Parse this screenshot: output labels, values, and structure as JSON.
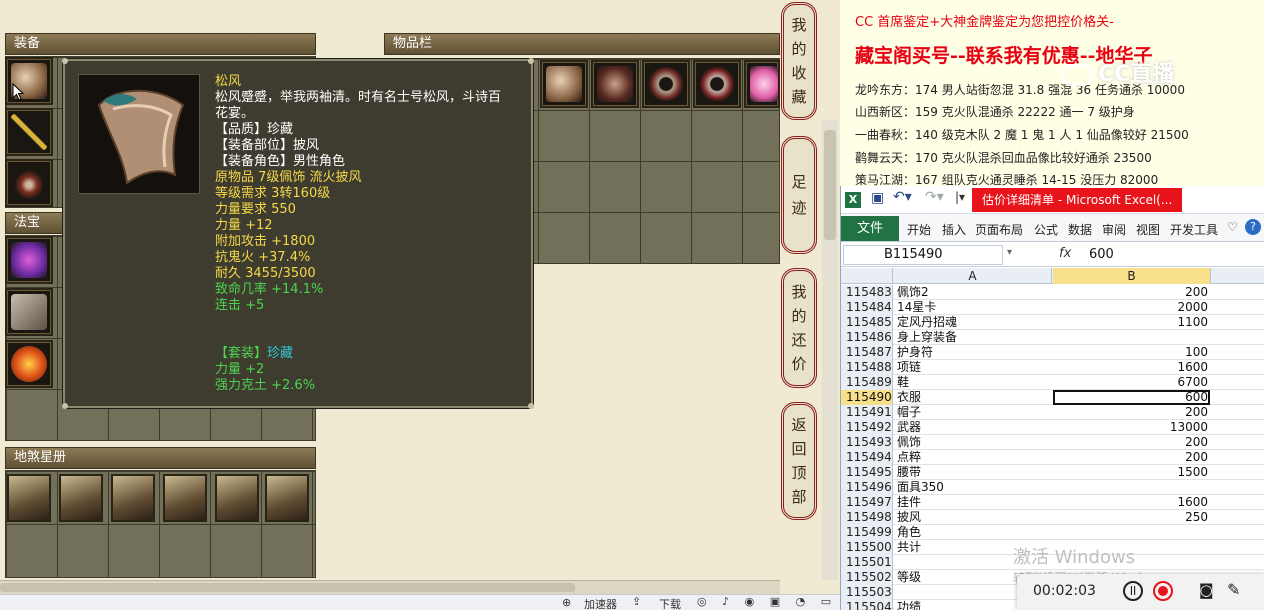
{
  "game": {
    "equip_header": "装备",
    "fabao_header": "法宝",
    "inventory_header": "物品栏",
    "dishagui_header": "地煞星册",
    "tooltip": {
      "name": "松风",
      "desc_line1": "松风蹙蹙，举我两袖清。时有名士号松风，斗诗百",
      "desc_line2": "花宴。",
      "quality": "【品质】珍藏",
      "slot": "【装备部位】披风",
      "role": "【装备角色】男性角色",
      "origin": "原物品 7级佩饰 流火披风",
      "level_req": "等级需求 3转160级",
      "str_req": "力量要求 550",
      "str": "力量 +12",
      "atk": "附加攻击 +1800",
      "resist": "抗鬼火 +37.4%",
      "durability": "耐久 3455/3500",
      "crit": "致命几率 +14.1%",
      "combo": "连击 +5",
      "set_label": "【套装】",
      "set_name": "珍藏",
      "set_str": "力量 +2",
      "set_bonus": "强力克土 +2.6%"
    },
    "bottom_bar": {
      "speed": "加速器",
      "download": "下载"
    }
  },
  "side_buttons": [
    {
      "label": "我的收藏"
    },
    {
      "label": "足迹"
    },
    {
      "label": "我的还价"
    },
    {
      "label": "返回顶部"
    }
  ],
  "right_text": {
    "line_top": "CC 首席鉴定+大神金牌鉴定为您把控价格关-",
    "headline": "藏宝阁买号--联系我有优惠--地华子",
    "items": [
      "龙吟东方：174 男人站街忽混 31.8 强混 36 任务通杀 10000",
      "山西新区：159 克火队混通杀 22222 通一 7 级护身",
      "一曲春秋：140 级克木队 2 魔 1 鬼 1 人 1 仙品像较好 21500",
      "鹳舞云天：170 克火队混杀回血品像比较好通杀 23500",
      "策马江湖：167 组队克火通灵睡杀 14-15 没压力 82000"
    ],
    "watermark": "CC直播"
  },
  "excel": {
    "title": "估价详细清单 - Microsoft Excel(...",
    "ribbon_tabs": [
      "文件",
      "开始",
      "插入",
      "页面布局",
      "公式",
      "数据",
      "审阅",
      "视图",
      "开发工具"
    ],
    "name_box": "B115490",
    "fx": "fx",
    "formula_value": "600",
    "col_a": "A",
    "col_b": "B",
    "rows": [
      {
        "n": "115483",
        "a": "佩饰2",
        "b": "200"
      },
      {
        "n": "115484",
        "a": "14星卡",
        "b": "2000"
      },
      {
        "n": "115485",
        "a": "定风丹招魂",
        "b": "1100"
      },
      {
        "n": "115486",
        "a": "身上穿装备",
        "b": ""
      },
      {
        "n": "115487",
        "a": "护身符",
        "b": "100"
      },
      {
        "n": "115488",
        "a": "项链",
        "b": "1600"
      },
      {
        "n": "115489",
        "a": "鞋",
        "b": "6700"
      },
      {
        "n": "115490",
        "a": "衣服",
        "b": "600"
      },
      {
        "n": "115491",
        "a": "帽子",
        "b": "200"
      },
      {
        "n": "115492",
        "a": "武器",
        "b": "13000"
      },
      {
        "n": "115493",
        "a": "佩饰",
        "b": "200"
      },
      {
        "n": "115494",
        "a": "点粹",
        "b": "200"
      },
      {
        "n": "115495",
        "a": "腰带",
        "b": "1500"
      },
      {
        "n": "115496",
        "a": "面具350",
        "b": ""
      },
      {
        "n": "115497",
        "a": "挂件",
        "b": "1600"
      },
      {
        "n": "115498",
        "a": "披风",
        "b": "250"
      },
      {
        "n": "115499",
        "a": "角色",
        "b": ""
      },
      {
        "n": "115500",
        "a": "共计",
        "b": ""
      },
      {
        "n": "115501",
        "a": "",
        "b": ""
      },
      {
        "n": "115502",
        "a": "等级",
        "b": ""
      },
      {
        "n": "115503",
        "a": "",
        "b": ""
      },
      {
        "n": "115504",
        "a": "功绩",
        "b": ""
      }
    ],
    "activate_line1": "激活 Windows",
    "activate_line2": "转到\"设置\"以激活 Windows。"
  },
  "recorder": {
    "time": "00:02:03"
  },
  "colors": {
    "excel_green": "#217346",
    "title_red": "#e8141b",
    "headline_red": "#e60012"
  }
}
